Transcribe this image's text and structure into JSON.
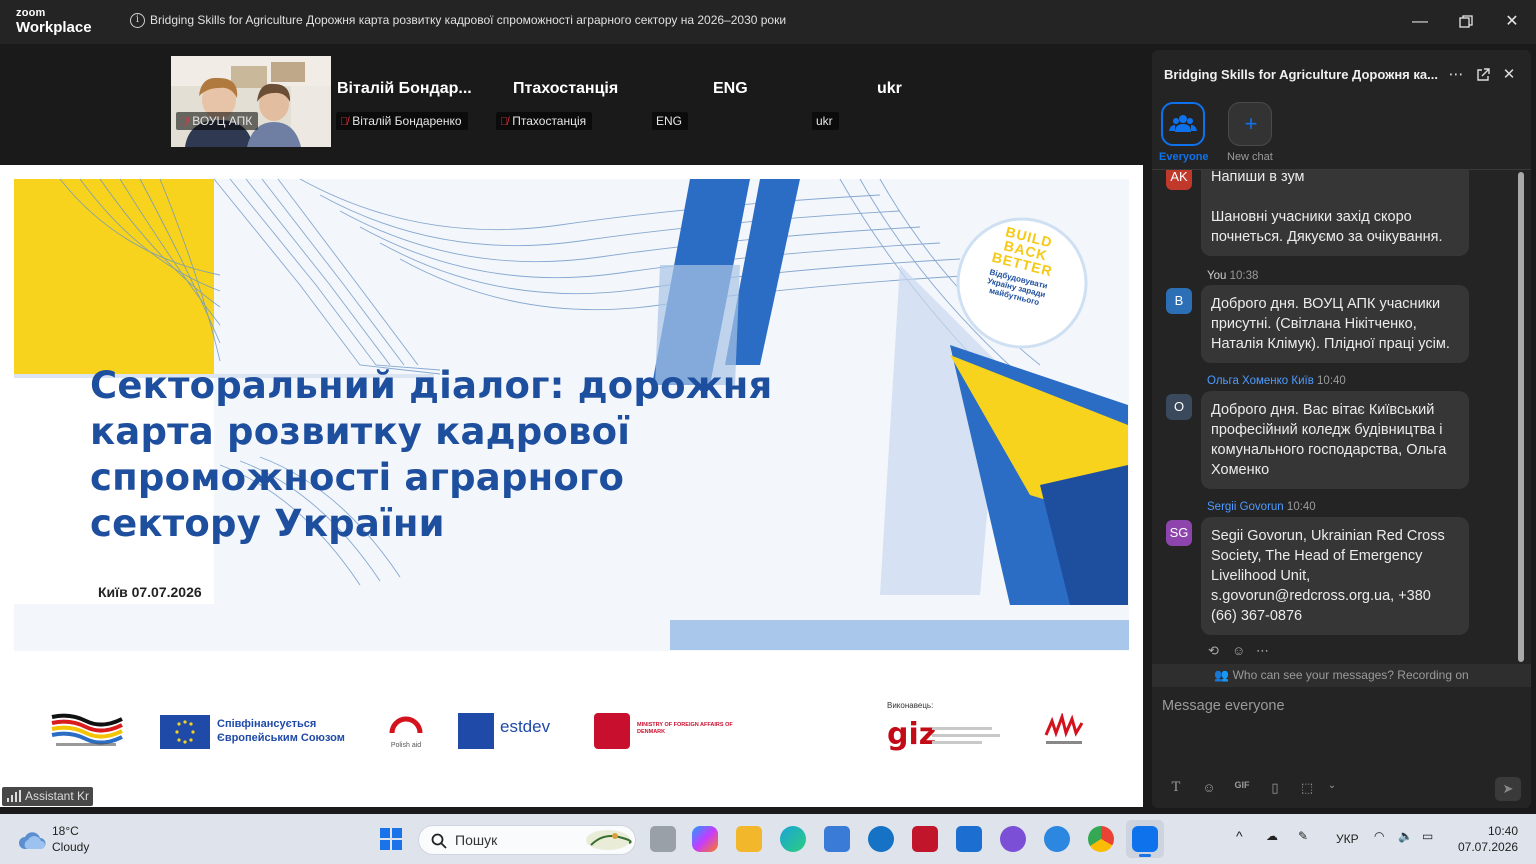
{
  "window": {
    "logo_line1": "zoom",
    "logo_line2": "Workplace",
    "title": "Bridging Skills for Agriculture  Дорожня карта розвитку кадрової спроможності аграрного сектору на 2026–2030 роки"
  },
  "participants": [
    {
      "label": "ВОУЦ АПК",
      "muted": true,
      "has_video": true
    },
    {
      "big_name": "Віталій Бондар...",
      "label": "Віталій Бондаренко",
      "muted": true
    },
    {
      "big_name": "Птахостанція",
      "label": "Птахостанція",
      "muted": true
    },
    {
      "big_name": "ENG",
      "label": "ENG",
      "muted": false
    },
    {
      "big_name": "ukr",
      "label": "ukr",
      "muted": false
    }
  ],
  "slide": {
    "badge_line1": "BUILD",
    "badge_line2": "BACK",
    "badge_line3": "BETTER",
    "badge_sub1": "Відбудовувати",
    "badge_sub2": "Україну заради",
    "badge_sub3": "майбутнього",
    "title_lines": [
      "Секторальний діалог: дорожня",
      "карта розвитку кадрової",
      "спроможності аграрного",
      "сектору України"
    ],
    "date": "Київ 07.07.2026",
    "eu_text1": "Співфінансується",
    "eu_text2": "Європейським Союзом",
    "polish_aid": "Polish aid",
    "estdev": "estdev",
    "denmark": "MINISTRY OF FOREIGN AFFAIRS OF DENMARK",
    "implementer": "Виконавець:",
    "giz": "giz"
  },
  "assistant_label": "Assistant Kr",
  "chat": {
    "title": "Bridging Skills for Agriculture  Дорожня ка...",
    "tabs": [
      {
        "label": "Everyone"
      },
      {
        "label": "New chat"
      }
    ],
    "messages": [
      {
        "avatar": "AK",
        "avatar_color": "#c0392b",
        "lines": [
          "Напиши в зум",
          "",
          "Шановні учасники захід скоро почнеться. Дякуємо за очікування."
        ]
      },
      {
        "sender": "You",
        "time": "10:38",
        "avatar": "B",
        "avatar_color": "#2d6fb5",
        "text": "Доброго дня. ВОУЦ АПК учасники присутні. (Світлана Нікітченко, Наталія Клімук). Плідної праці усім."
      },
      {
        "sender": "Ольга Хоменко Київ",
        "time": "10:40",
        "avatar": "O",
        "avatar_color": "#3a4a5c",
        "text": "Доброго дня. Вас вітає Київський професійний коледж будівництва і комунального господарства, Ольга Хоменко"
      },
      {
        "sender": "Sergii Govorun",
        "time": "10:40",
        "avatar": "SG",
        "avatar_color": "#8e44ad",
        "text": "Segii Govorun, Ukrainian Red Cross Society, The Head of Emergency Livelihood Unit, s.govorun@redcross.org.ua, +380 (66) 367-0876"
      }
    ],
    "privacy": "Who can see your messages? Recording on",
    "input_placeholder": "Message everyone",
    "accent": "#0e72ed"
  },
  "taskbar": {
    "temp": "18°C",
    "condition": "Cloudy",
    "search_placeholder": "Пошук",
    "language": "УКР",
    "time": "10:40",
    "date": "07.07.2026"
  }
}
